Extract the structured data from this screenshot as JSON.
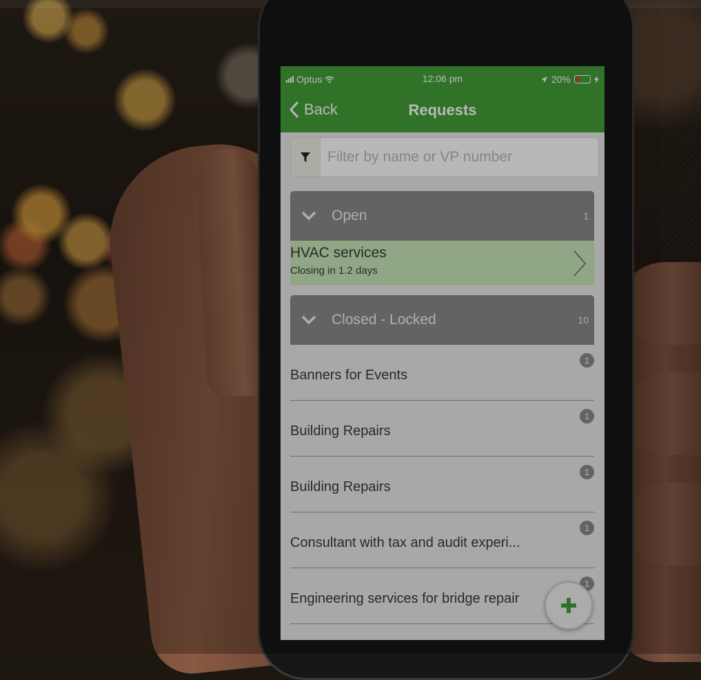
{
  "status_bar": {
    "carrier": "Optus",
    "time": "12:06 pm",
    "battery": "20%"
  },
  "nav": {
    "back_label": "Back",
    "title": "Requests"
  },
  "filter": {
    "placeholder": "Filter by name or VP number"
  },
  "sections": {
    "open": {
      "label": "Open",
      "count": "1",
      "items": [
        {
          "title": "HVAC services",
          "subtitle": "Closing in 1.2 days"
        }
      ]
    },
    "closed": {
      "label": "Closed - Locked",
      "count": "10",
      "items": [
        {
          "title": "Banners for Events",
          "badge": "1"
        },
        {
          "title": "Building Repairs",
          "badge": "1"
        },
        {
          "title": "Building Repairs",
          "badge": "1"
        },
        {
          "title": "Consultant with tax and audit experi...",
          "badge": "1"
        },
        {
          "title": "Engineering services for bridge repair",
          "badge": "1"
        }
      ]
    }
  },
  "colors": {
    "accent": "#43a038",
    "open_item_bg": "#c9e6b9",
    "section_header": "#8a8a8a"
  },
  "icons": {
    "filter": "filter-icon",
    "back": "chevron-left-icon",
    "add": "plus-icon"
  }
}
